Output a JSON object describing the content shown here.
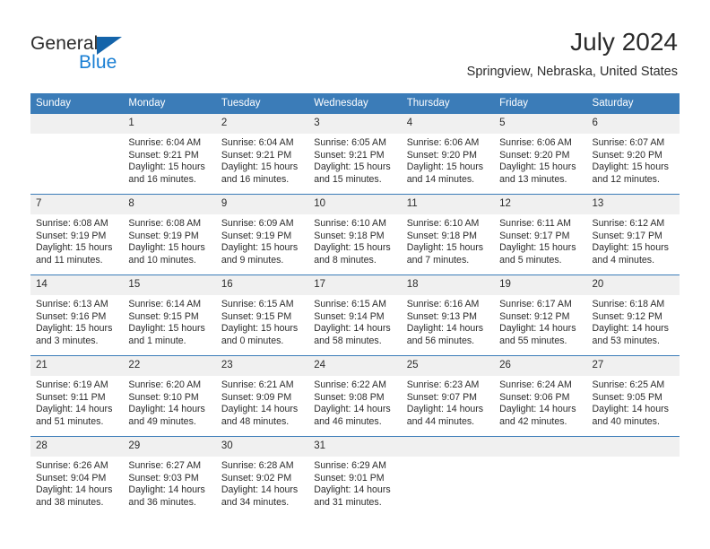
{
  "logo": {
    "word1": "General",
    "word2": "Blue",
    "triangle_color": "#1464aa",
    "blue_color": "#1a7fd4"
  },
  "header": {
    "title": "July 2024",
    "subtitle": "Springview, Nebraska, United States"
  },
  "colors": {
    "header_blue": "#3b7cb8",
    "daynum_band": "#f0f0f0",
    "text": "#2b2b2b"
  },
  "calendar": {
    "day_names": [
      "Sunday",
      "Monday",
      "Tuesday",
      "Wednesday",
      "Thursday",
      "Friday",
      "Saturday"
    ],
    "weeks": [
      [
        {
          "day": "",
          "empty": true
        },
        {
          "day": "1",
          "sunrise": "Sunrise: 6:04 AM",
          "sunset": "Sunset: 9:21 PM",
          "daylight": "Daylight: 15 hours and 16 minutes."
        },
        {
          "day": "2",
          "sunrise": "Sunrise: 6:04 AM",
          "sunset": "Sunset: 9:21 PM",
          "daylight": "Daylight: 15 hours and 16 minutes."
        },
        {
          "day": "3",
          "sunrise": "Sunrise: 6:05 AM",
          "sunset": "Sunset: 9:21 PM",
          "daylight": "Daylight: 15 hours and 15 minutes."
        },
        {
          "day": "4",
          "sunrise": "Sunrise: 6:06 AM",
          "sunset": "Sunset: 9:20 PM",
          "daylight": "Daylight: 15 hours and 14 minutes."
        },
        {
          "day": "5",
          "sunrise": "Sunrise: 6:06 AM",
          "sunset": "Sunset: 9:20 PM",
          "daylight": "Daylight: 15 hours and 13 minutes."
        },
        {
          "day": "6",
          "sunrise": "Sunrise: 6:07 AM",
          "sunset": "Sunset: 9:20 PM",
          "daylight": "Daylight: 15 hours and 12 minutes."
        }
      ],
      [
        {
          "day": "7",
          "sunrise": "Sunrise: 6:08 AM",
          "sunset": "Sunset: 9:19 PM",
          "daylight": "Daylight: 15 hours and 11 minutes."
        },
        {
          "day": "8",
          "sunrise": "Sunrise: 6:08 AM",
          "sunset": "Sunset: 9:19 PM",
          "daylight": "Daylight: 15 hours and 10 minutes."
        },
        {
          "day": "9",
          "sunrise": "Sunrise: 6:09 AM",
          "sunset": "Sunset: 9:19 PM",
          "daylight": "Daylight: 15 hours and 9 minutes."
        },
        {
          "day": "10",
          "sunrise": "Sunrise: 6:10 AM",
          "sunset": "Sunset: 9:18 PM",
          "daylight": "Daylight: 15 hours and 8 minutes."
        },
        {
          "day": "11",
          "sunrise": "Sunrise: 6:10 AM",
          "sunset": "Sunset: 9:18 PM",
          "daylight": "Daylight: 15 hours and 7 minutes."
        },
        {
          "day": "12",
          "sunrise": "Sunrise: 6:11 AM",
          "sunset": "Sunset: 9:17 PM",
          "daylight": "Daylight: 15 hours and 5 minutes."
        },
        {
          "day": "13",
          "sunrise": "Sunrise: 6:12 AM",
          "sunset": "Sunset: 9:17 PM",
          "daylight": "Daylight: 15 hours and 4 minutes."
        }
      ],
      [
        {
          "day": "14",
          "sunrise": "Sunrise: 6:13 AM",
          "sunset": "Sunset: 9:16 PM",
          "daylight": "Daylight: 15 hours and 3 minutes."
        },
        {
          "day": "15",
          "sunrise": "Sunrise: 6:14 AM",
          "sunset": "Sunset: 9:15 PM",
          "daylight": "Daylight: 15 hours and 1 minute."
        },
        {
          "day": "16",
          "sunrise": "Sunrise: 6:15 AM",
          "sunset": "Sunset: 9:15 PM",
          "daylight": "Daylight: 15 hours and 0 minutes."
        },
        {
          "day": "17",
          "sunrise": "Sunrise: 6:15 AM",
          "sunset": "Sunset: 9:14 PM",
          "daylight": "Daylight: 14 hours and 58 minutes."
        },
        {
          "day": "18",
          "sunrise": "Sunrise: 6:16 AM",
          "sunset": "Sunset: 9:13 PM",
          "daylight": "Daylight: 14 hours and 56 minutes."
        },
        {
          "day": "19",
          "sunrise": "Sunrise: 6:17 AM",
          "sunset": "Sunset: 9:12 PM",
          "daylight": "Daylight: 14 hours and 55 minutes."
        },
        {
          "day": "20",
          "sunrise": "Sunrise: 6:18 AM",
          "sunset": "Sunset: 9:12 PM",
          "daylight": "Daylight: 14 hours and 53 minutes."
        }
      ],
      [
        {
          "day": "21",
          "sunrise": "Sunrise: 6:19 AM",
          "sunset": "Sunset: 9:11 PM",
          "daylight": "Daylight: 14 hours and 51 minutes."
        },
        {
          "day": "22",
          "sunrise": "Sunrise: 6:20 AM",
          "sunset": "Sunset: 9:10 PM",
          "daylight": "Daylight: 14 hours and 49 minutes."
        },
        {
          "day": "23",
          "sunrise": "Sunrise: 6:21 AM",
          "sunset": "Sunset: 9:09 PM",
          "daylight": "Daylight: 14 hours and 48 minutes."
        },
        {
          "day": "24",
          "sunrise": "Sunrise: 6:22 AM",
          "sunset": "Sunset: 9:08 PM",
          "daylight": "Daylight: 14 hours and 46 minutes."
        },
        {
          "day": "25",
          "sunrise": "Sunrise: 6:23 AM",
          "sunset": "Sunset: 9:07 PM",
          "daylight": "Daylight: 14 hours and 44 minutes."
        },
        {
          "day": "26",
          "sunrise": "Sunrise: 6:24 AM",
          "sunset": "Sunset: 9:06 PM",
          "daylight": "Daylight: 14 hours and 42 minutes."
        },
        {
          "day": "27",
          "sunrise": "Sunrise: 6:25 AM",
          "sunset": "Sunset: 9:05 PM",
          "daylight": "Daylight: 14 hours and 40 minutes."
        }
      ],
      [
        {
          "day": "28",
          "sunrise": "Sunrise: 6:26 AM",
          "sunset": "Sunset: 9:04 PM",
          "daylight": "Daylight: 14 hours and 38 minutes."
        },
        {
          "day": "29",
          "sunrise": "Sunrise: 6:27 AM",
          "sunset": "Sunset: 9:03 PM",
          "daylight": "Daylight: 14 hours and 36 minutes."
        },
        {
          "day": "30",
          "sunrise": "Sunrise: 6:28 AM",
          "sunset": "Sunset: 9:02 PM",
          "daylight": "Daylight: 14 hours and 34 minutes."
        },
        {
          "day": "31",
          "sunrise": "Sunrise: 6:29 AM",
          "sunset": "Sunset: 9:01 PM",
          "daylight": "Daylight: 14 hours and 31 minutes."
        },
        {
          "day": "",
          "empty": true
        },
        {
          "day": "",
          "empty": true
        },
        {
          "day": "",
          "empty": true
        }
      ]
    ]
  }
}
